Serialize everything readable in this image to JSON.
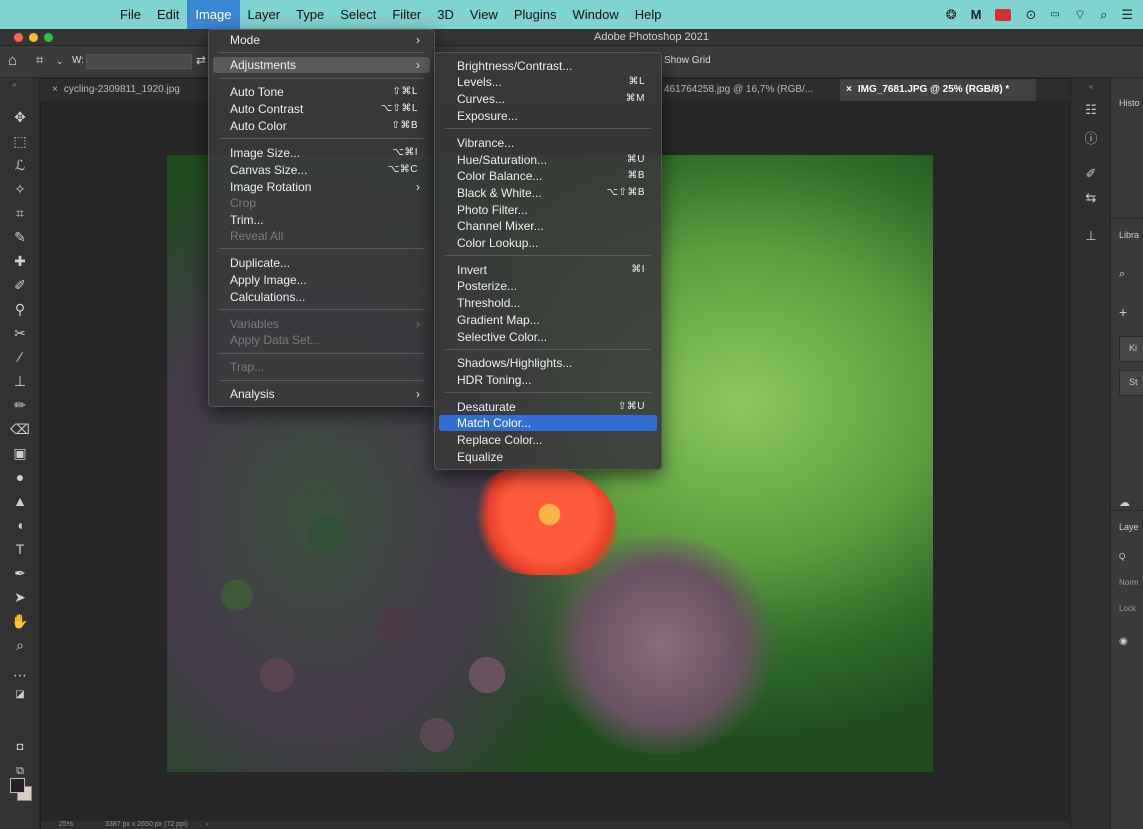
{
  "menubar": {
    "items": [
      "File",
      "Edit",
      "Image",
      "Layer",
      "Type",
      "Select",
      "Filter",
      "3D",
      "View",
      "Plugins",
      "Window",
      "Help"
    ],
    "active_index": 2,
    "status_icons": [
      "creative-cloud-icon",
      "malwarebytes-icon",
      "flag-icon",
      "play-icon",
      "battery-icon",
      "wifi-icon",
      "search-icon",
      "control-center-icon"
    ]
  },
  "window": {
    "title": "Adobe Photoshop 2021"
  },
  "options": {
    "width_label": "W:",
    "show_grid": "Show Grid"
  },
  "tabs": [
    {
      "label": "cycling-2309811_1920.jpg",
      "active": false
    },
    {
      "label": "461764258.jpg @ 16,7% (RGB/...",
      "active": false
    },
    {
      "label": "IMG_7681.JPG @ 25% (RGB/8) *",
      "active": true
    }
  ],
  "image_menu": {
    "items": [
      {
        "label": "Mode",
        "shortcut": "",
        "submenu": true,
        "disabled": false
      },
      {
        "label": "Adjustments",
        "shortcut": "",
        "submenu": true,
        "disabled": false,
        "highlighted": true
      },
      {
        "label": "Auto Tone",
        "shortcut": "⇧⌘L",
        "submenu": false,
        "disabled": false
      },
      {
        "label": "Auto Contrast",
        "shortcut": "⌥⇧⌘L",
        "submenu": false,
        "disabled": false
      },
      {
        "label": "Auto Color",
        "shortcut": "⇧⌘B",
        "submenu": false,
        "disabled": false
      },
      {
        "label": "Image Size...",
        "shortcut": "⌥⌘I",
        "submenu": false,
        "disabled": false
      },
      {
        "label": "Canvas Size...",
        "shortcut": "⌥⌘C",
        "submenu": false,
        "disabled": false
      },
      {
        "label": "Image Rotation",
        "shortcut": "",
        "submenu": true,
        "disabled": false
      },
      {
        "label": "Crop",
        "shortcut": "",
        "submenu": false,
        "disabled": true
      },
      {
        "label": "Trim...",
        "shortcut": "",
        "submenu": false,
        "disabled": false
      },
      {
        "label": "Reveal All",
        "shortcut": "",
        "submenu": false,
        "disabled": true
      },
      {
        "label": "Duplicate...",
        "shortcut": "",
        "submenu": false,
        "disabled": false
      },
      {
        "label": "Apply Image...",
        "shortcut": "",
        "submenu": false,
        "disabled": false
      },
      {
        "label": "Calculations...",
        "shortcut": "",
        "submenu": false,
        "disabled": false
      },
      {
        "label": "Variables",
        "shortcut": "",
        "submenu": true,
        "disabled": true
      },
      {
        "label": "Apply Data Set...",
        "shortcut": "",
        "submenu": false,
        "disabled": true
      },
      {
        "label": "Trap...",
        "shortcut": "",
        "submenu": false,
        "disabled": true
      },
      {
        "label": "Analysis",
        "shortcut": "",
        "submenu": true,
        "disabled": false
      }
    ]
  },
  "adjustments_menu": {
    "items": [
      {
        "label": "Brightness/Contrast...",
        "shortcut": ""
      },
      {
        "label": "Levels...",
        "shortcut": "⌘L"
      },
      {
        "label": "Curves...",
        "shortcut": "⌘M"
      },
      {
        "label": "Exposure...",
        "shortcut": ""
      },
      {
        "label": "Vibrance...",
        "shortcut": ""
      },
      {
        "label": "Hue/Saturation...",
        "shortcut": "⌘U"
      },
      {
        "label": "Color Balance...",
        "shortcut": "⌘B"
      },
      {
        "label": "Black & White...",
        "shortcut": "⌥⇧⌘B"
      },
      {
        "label": "Photo Filter...",
        "shortcut": ""
      },
      {
        "label": "Channel Mixer...",
        "shortcut": ""
      },
      {
        "label": "Color Lookup...",
        "shortcut": ""
      },
      {
        "label": "Invert",
        "shortcut": "⌘I"
      },
      {
        "label": "Posterize...",
        "shortcut": ""
      },
      {
        "label": "Threshold...",
        "shortcut": ""
      },
      {
        "label": "Gradient Map...",
        "shortcut": ""
      },
      {
        "label": "Selective Color...",
        "shortcut": ""
      },
      {
        "label": "Shadows/Highlights...",
        "shortcut": ""
      },
      {
        "label": "HDR Toning...",
        "shortcut": ""
      },
      {
        "label": "Desaturate",
        "shortcut": "⇧⌘U"
      },
      {
        "label": "Match Color...",
        "shortcut": "",
        "selected": true
      },
      {
        "label": "Replace Color...",
        "shortcut": ""
      },
      {
        "label": "Equalize",
        "shortcut": ""
      }
    ]
  },
  "right_panel": {
    "history_label": "Histo",
    "libraries_label": "Libra",
    "lib_item1": "Ki",
    "lib_item2": "St",
    "layers_label": "Laye",
    "layers_search": "Q",
    "normal": "Norm",
    "lock": "Lock"
  },
  "status": {
    "zoom": "25%",
    "doc_size": "3387 px x 2650 px (72 ppi)",
    "arrow": "›"
  },
  "colors": {
    "menubar": "#7fd3d0",
    "selection": "#2f6fd6",
    "accent": "#3a86d6"
  }
}
